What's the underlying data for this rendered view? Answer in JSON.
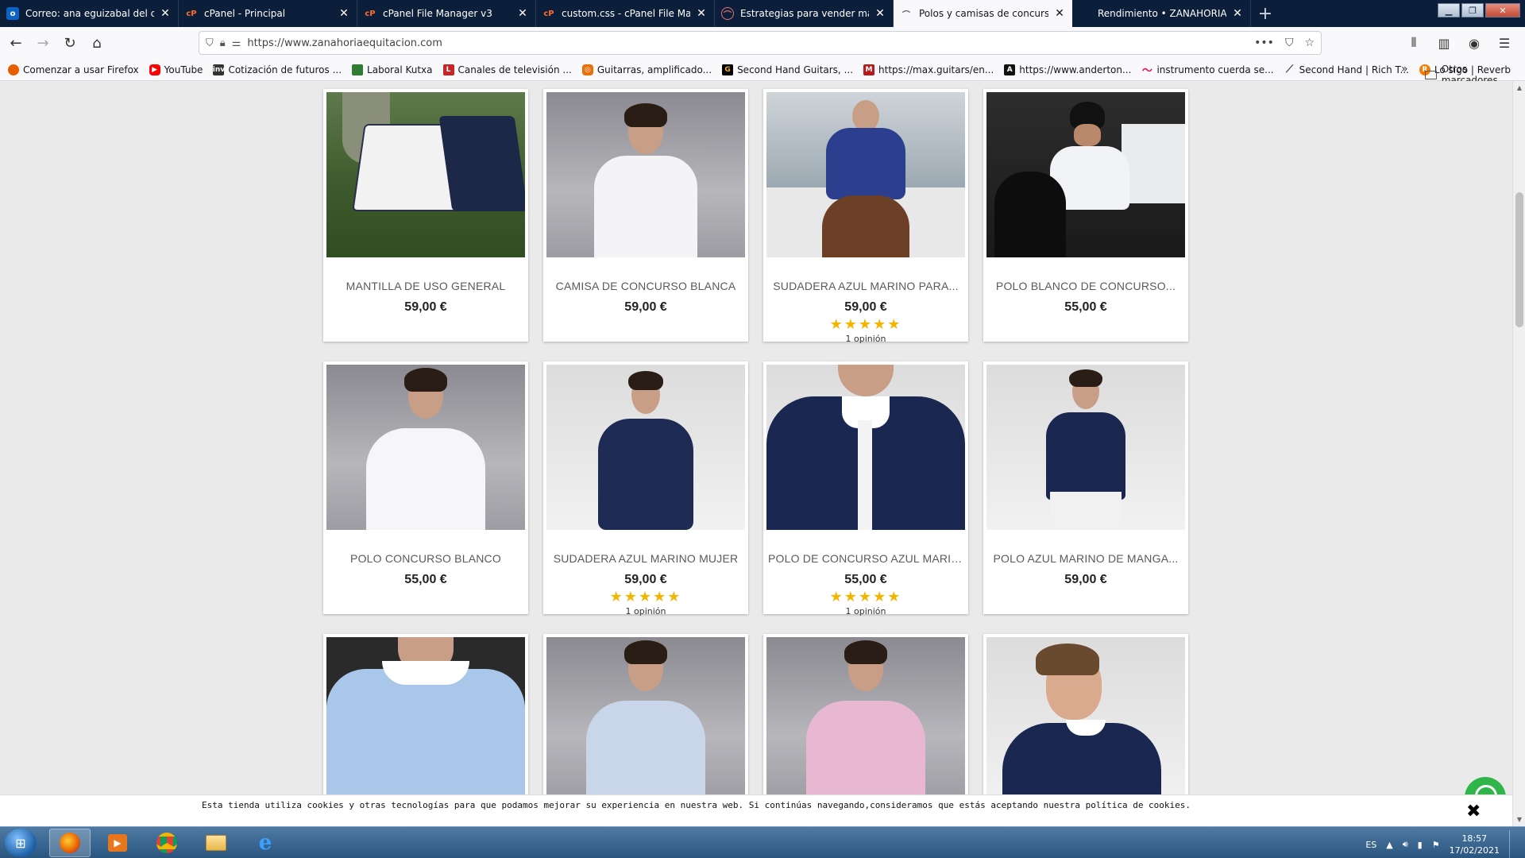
{
  "browser": {
    "tabs": [
      {
        "title": "Correo: ana eguizabal del campo",
        "favicon": "outlook-icon",
        "active": false
      },
      {
        "title": "cPanel - Principal",
        "favicon": "cpanel-icon",
        "active": false
      },
      {
        "title": "cPanel File Manager v3",
        "favicon": "cpanel-icon",
        "active": false
      },
      {
        "title": "custom.css - cPanel File Manager",
        "favicon": "cpanel-icon",
        "active": false
      },
      {
        "title": "Estrategias para vender más y d",
        "favicon": "site-icon",
        "active": false
      },
      {
        "title": "Polos y camisas de concurso de",
        "favicon": "horseshoe-icon",
        "active": true
      },
      {
        "title": "Rendimiento • ZANAHORIA EQ",
        "favicon": "",
        "active": false
      }
    ],
    "url": "https://www.zanahoriaequitacion.com",
    "bookmarks": [
      {
        "label": "Comenzar a usar Firefox",
        "icon": "firefox-icon",
        "color": "#e66000"
      },
      {
        "label": "YouTube",
        "icon": "youtube-icon",
        "color": "#ff0000"
      },
      {
        "label": "Cotización de futuros ...",
        "icon": "investing-icon",
        "color": "#333333"
      },
      {
        "label": "Laboral Kutxa",
        "icon": "bank-icon",
        "color": "#2e7d32"
      },
      {
        "label": "Canales de televisión ...",
        "icon": "tv-icon",
        "color": "#c62828"
      },
      {
        "label": "Guitarras, amplificado...",
        "icon": "shop-icon",
        "color": "#ef6c00"
      },
      {
        "label": "Second Hand Guitars, ...",
        "icon": "guitar-icon",
        "color": "#000000"
      },
      {
        "label": "https://max.guitars/en...",
        "icon": "max-icon",
        "color": "#b71c1c"
      },
      {
        "label": "https://www.anderton...",
        "icon": "andertons-icon",
        "color": "#111111"
      },
      {
        "label": "instrumento cuerda se...",
        "icon": "string-icon",
        "color": "#d81b60"
      },
      {
        "label": "Second Hand | Rich T...",
        "icon": "guitar-neck-icon",
        "color": "#444444"
      },
      {
        "label": "Lo sigo | Reverb",
        "icon": "reverb-icon",
        "color": "#f57c00"
      }
    ],
    "other_bookmarks": "Otros marcadores"
  },
  "products": [
    {
      "name": "MANTILLA DE USO GENERAL",
      "price": "59,00 €",
      "rating": "",
      "reviews": ""
    },
    {
      "name": "CAMISA DE CONCURSO BLANCA",
      "price": "59,00 €",
      "rating": "",
      "reviews": ""
    },
    {
      "name": "SUDADERA AZUL MARINO PARA...",
      "price": "59,00 €",
      "rating": "★★★★★",
      "reviews": "1 opinión"
    },
    {
      "name": "POLO BLANCO DE CONCURSO...",
      "price": "55,00 €",
      "rating": "",
      "reviews": ""
    },
    {
      "name": "POLO CONCURSO BLANCO",
      "price": "55,00 €",
      "rating": "",
      "reviews": ""
    },
    {
      "name": "SUDADERA AZUL MARINO MUJER",
      "price": "59,00 €",
      "rating": "★★★★★",
      "reviews": "1 opinión"
    },
    {
      "name": "POLO DE CONCURSO AZUL MARINO",
      "price": "55,00 €",
      "rating": "★★★★★",
      "reviews": "1 opinión"
    },
    {
      "name": "POLO AZUL MARINO DE MANGA...",
      "price": "59,00 €",
      "rating": "",
      "reviews": ""
    },
    {
      "name": "",
      "price": "",
      "rating": "",
      "reviews": ""
    },
    {
      "name": "",
      "price": "",
      "rating": "",
      "reviews": ""
    },
    {
      "name": "",
      "price": "",
      "rating": "",
      "reviews": ""
    },
    {
      "name": "",
      "price": "",
      "rating": "",
      "reviews": ""
    }
  ],
  "cookie_banner": {
    "text": "Esta tienda utiliza cookies y otras tecnologías para que podamos mejorar su experiencia en nuestra web. Si continúas navegando,consideramos que estás aceptando nuestra política de cookies.",
    "close": "✖"
  },
  "taskbar": {
    "language": "ES",
    "time": "18:57",
    "date": "17/02/2021"
  },
  "colors": {
    "star": "#f3b500",
    "tabbar": "#0b1f3a",
    "page_bg": "#eaeaea"
  }
}
